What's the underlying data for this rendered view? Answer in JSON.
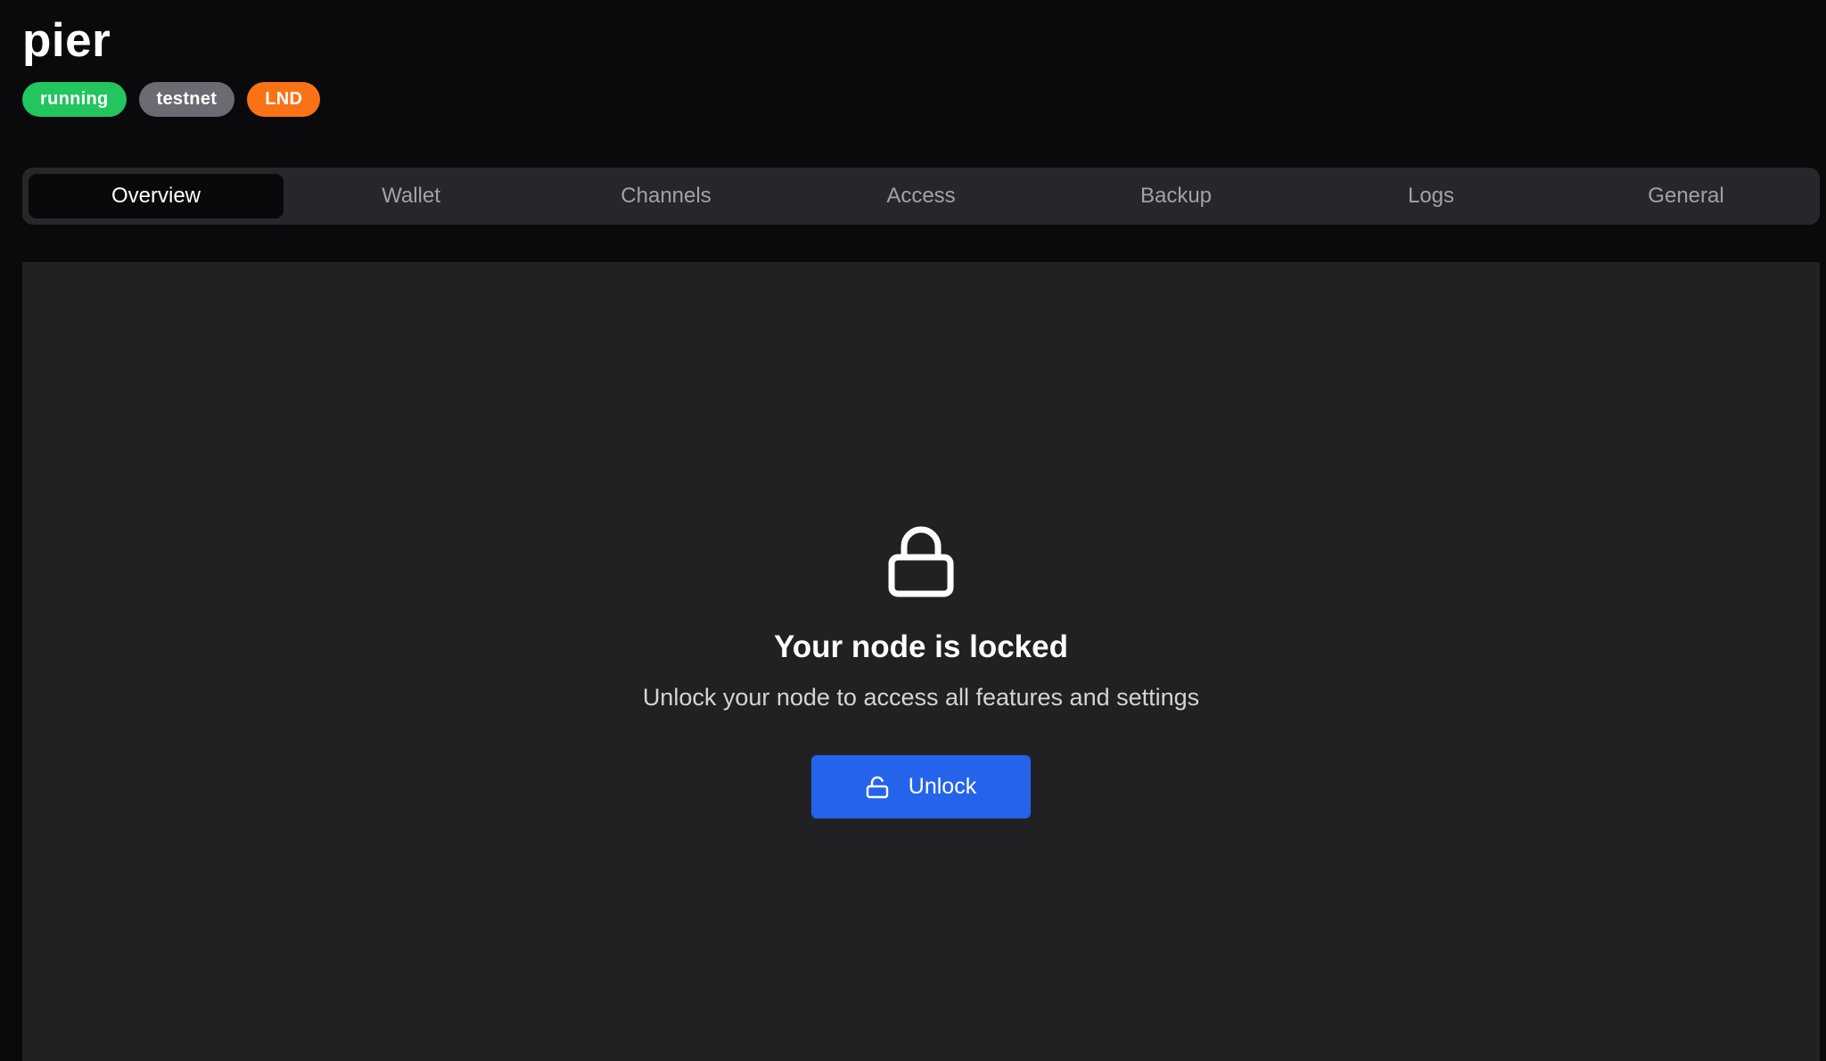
{
  "app": {
    "title": "pier"
  },
  "badges": {
    "status": "running",
    "network": "testnet",
    "implementation": "LND"
  },
  "tabs": [
    {
      "label": "Overview",
      "active": true
    },
    {
      "label": "Wallet",
      "active": false
    },
    {
      "label": "Channels",
      "active": false
    },
    {
      "label": "Access",
      "active": false
    },
    {
      "label": "Backup",
      "active": false
    },
    {
      "label": "Logs",
      "active": false
    },
    {
      "label": "General",
      "active": false
    }
  ],
  "locked": {
    "icon": "lock-icon",
    "title": "Your node is locked",
    "subtitle": "Unlock your node to access all features and settings",
    "button_label": "Unlock",
    "button_icon": "unlock-icon"
  },
  "colors": {
    "background": "#0a0a0c",
    "panel": "#212124",
    "running": "#22c55e",
    "network": "#6b6b73",
    "implementation": "#f97316",
    "primary_button": "#2563eb"
  }
}
